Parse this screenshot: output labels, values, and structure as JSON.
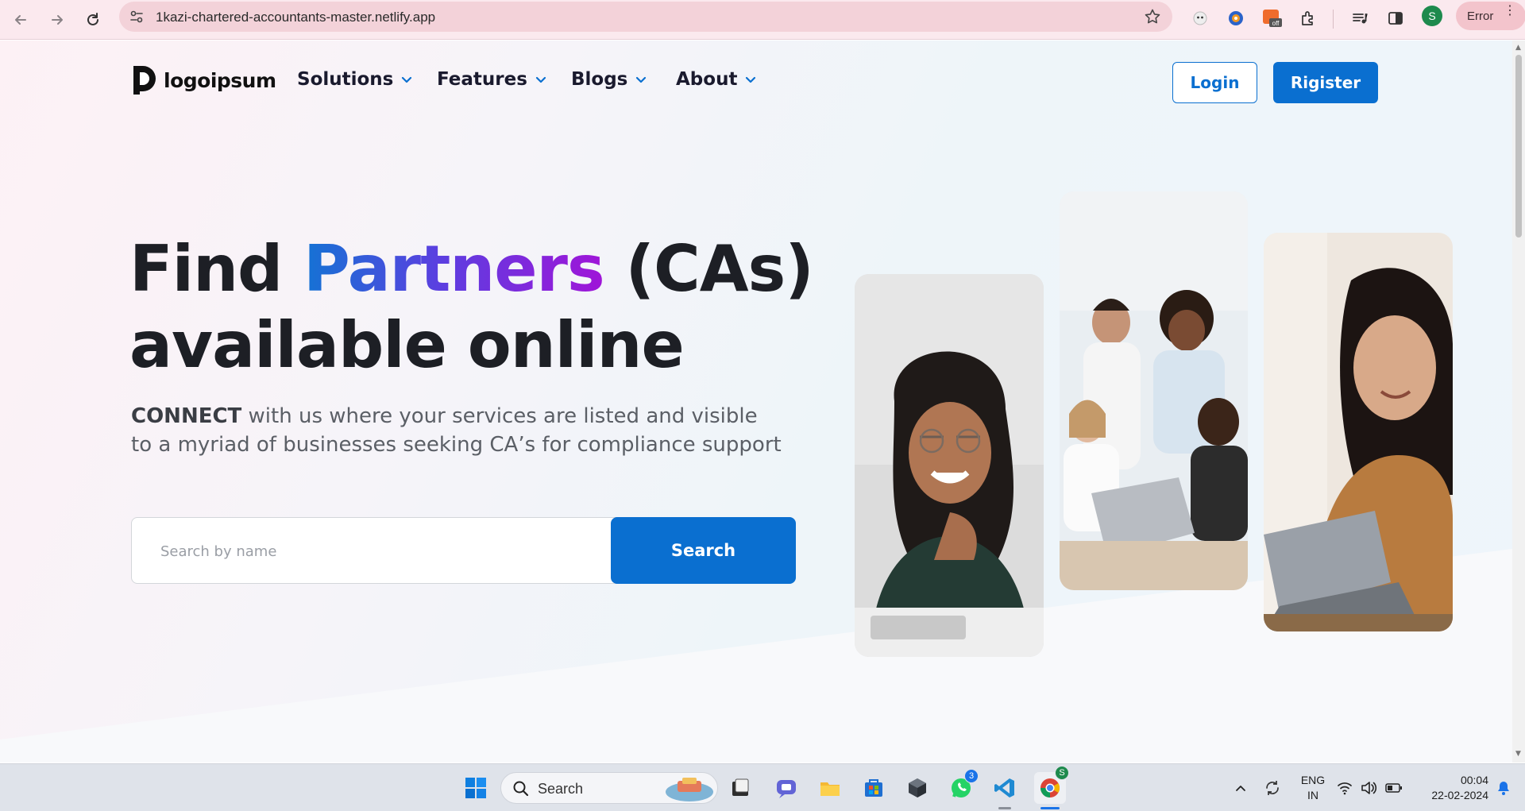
{
  "browser": {
    "url": "1kazi-chartered-accountants-master.netlify.app",
    "profile_initial": "S",
    "status_pill": "Error"
  },
  "site": {
    "logo_text": "logoipsum",
    "nav": [
      {
        "label": "Solutions"
      },
      {
        "label": "Features"
      },
      {
        "label": "Blogs"
      },
      {
        "label": "About"
      }
    ],
    "login_label": "Login",
    "register_label": "Rigister"
  },
  "hero": {
    "title_prefix": "Find ",
    "title_highlight": "Partners",
    "title_suffix": " (CAs)",
    "title_line2": "available online",
    "subtitle_bold": "CONNECT",
    "subtitle_rest": " with us where your services are listed and visible to a myriad of businesses seeking CA’s for compliance support",
    "search_placeholder": "Search by name",
    "search_button": "Search"
  },
  "colors": {
    "brand_blue": "#0a6fd0",
    "gradient_start": "#1473d4",
    "gradient_end": "#a014d8"
  },
  "taskbar": {
    "search_label": "Search",
    "whatsapp_badge": "3",
    "lang_line1": "ENG",
    "lang_line2": "IN",
    "time": "00:04",
    "date": "22-02-2024",
    "apps": [
      "windows-start-icon",
      "file-viewer-icon",
      "teams-icon",
      "file-explorer-icon",
      "microsoft-store-icon",
      "app-cube-icon",
      "whatsapp-icon",
      "vscode-icon",
      "chrome-icon"
    ]
  }
}
